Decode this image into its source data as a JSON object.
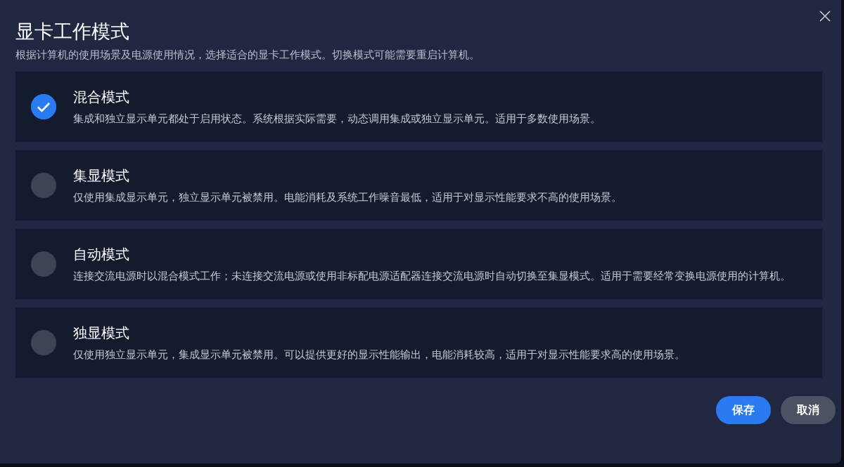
{
  "dialog": {
    "title": "显卡工作模式",
    "subtitle": "根据计算机的使用场景及电源使用情况，选择适合的显卡工作模式。切换模式可能需要重启计算机。"
  },
  "modes": [
    {
      "title": "混合模式",
      "description": "集成和独立显示单元都处于启用状态。系统根据实际需要，动态调用集成或独立显示单元。适用于多数使用场景。",
      "selected": true
    },
    {
      "title": "集显模式",
      "description": "仅使用集成显示单元，独立显示单元被禁用。电能消耗及系统工作噪音最低，适用于对显示性能要求不高的使用场景。",
      "selected": false
    },
    {
      "title": "自动模式",
      "description": "连接交流电源时以混合模式工作；未连接交流电源或使用非标配电源适配器连接交流电源时自动切换至集显模式。适用于需要经常变换电源使用的计算机。",
      "selected": false
    },
    {
      "title": "独显模式",
      "description": "仅使用独立显示单元，集成显示单元被禁用。可以提供更好的显示性能输出，电能消耗较高，适用于对显示性能要求高的使用场景。",
      "selected": false
    }
  ],
  "buttons": [
    {
      "label": "保存",
      "kind": "primary"
    },
    {
      "label": "取消",
      "kind": "secondary"
    }
  ]
}
